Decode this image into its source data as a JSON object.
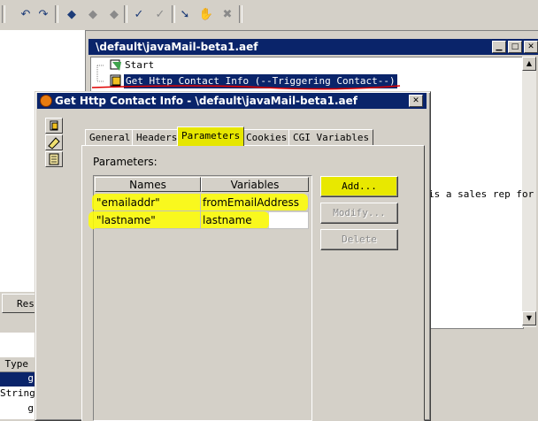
{
  "editor": {
    "title": "\\default\\javaMail-beta1.aef",
    "nodes": [
      {
        "label": "Start"
      },
      {
        "label": "Get Http Contact Info (--Triggering Contact--)"
      }
    ],
    "canvas_text": "is a sales rep for f"
  },
  "left_pane": {
    "button_label": "Res",
    "grid_header": "Type",
    "grid_rows": [
      "g",
      "String",
      "g"
    ]
  },
  "dialog": {
    "title": "Get Http Contact Info - \\default\\javaMail-beta1.aef",
    "tabs": [
      {
        "label": "General",
        "active": false
      },
      {
        "label": "Headers",
        "active": false
      },
      {
        "label": "Parameters",
        "active": true
      },
      {
        "label": "Cookies",
        "active": false
      },
      {
        "label": "CGI Variables",
        "active": false
      }
    ],
    "section_label": "Parameters:",
    "table": {
      "columns": [
        "Names",
        "Variables"
      ],
      "rows": [
        {
          "name": "\"emailaddr\"",
          "variable": "fromEmailAddress"
        },
        {
          "name": "\"lastname\"",
          "variable": "lastname"
        }
      ]
    },
    "buttons": {
      "add": "Add...",
      "modify": "Modify...",
      "delete": "Delete"
    }
  },
  "colors": {
    "title_bar": "#0a246a",
    "highlight": "#ffff00",
    "annotation_line": "#e00000"
  }
}
